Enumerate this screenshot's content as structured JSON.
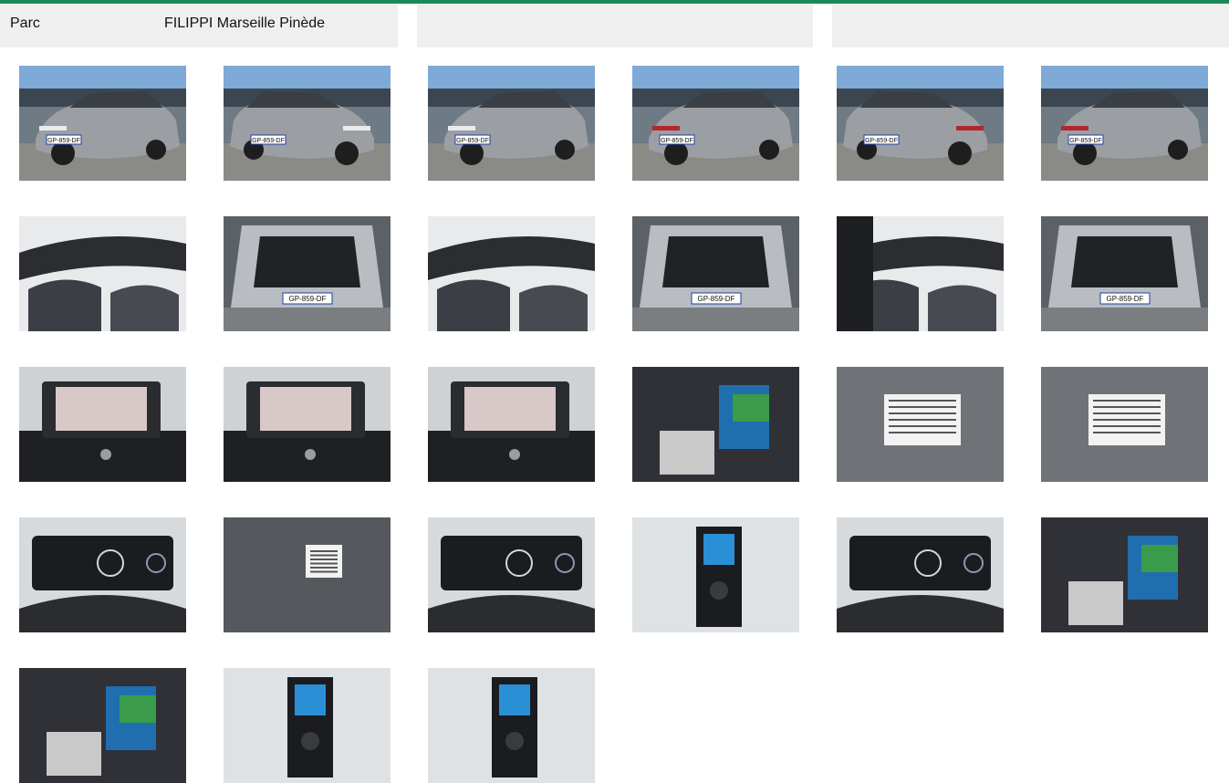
{
  "info": {
    "label": "Parc",
    "value": "FILIPPI Marseille Pinède"
  },
  "photos": [
    {
      "kind": "front-3q-left",
      "plate": "GP-859-DF"
    },
    {
      "kind": "front-3q-right",
      "plate": "GP-859-DF"
    },
    {
      "kind": "front",
      "plate": "GP-859-DF"
    },
    {
      "kind": "rear-3q-left",
      "plate": "GP-859-DF"
    },
    {
      "kind": "rear-3q-right",
      "plate": "GP-859-DF"
    },
    {
      "kind": "rear",
      "plate": "GP-859-DF"
    },
    {
      "kind": "interior-front",
      "plate": ""
    },
    {
      "kind": "trunk-open",
      "plate": "GP-859-DF"
    },
    {
      "kind": "interior-dash",
      "plate": ""
    },
    {
      "kind": "trunk-open",
      "plate": "GP-859-DF"
    },
    {
      "kind": "interior-door",
      "plate": ""
    },
    {
      "kind": "trunk-open",
      "plate": "GP-859-DF"
    },
    {
      "kind": "infotainment",
      "plate": ""
    },
    {
      "kind": "infotainment",
      "plate": ""
    },
    {
      "kind": "infotainment",
      "plate": ""
    },
    {
      "kind": "documents-seat",
      "plate": ""
    },
    {
      "kind": "vin-plate",
      "plate": ""
    },
    {
      "kind": "vin-plate",
      "plate": ""
    },
    {
      "kind": "cluster",
      "plate": ""
    },
    {
      "kind": "vin-plate-far",
      "plate": ""
    },
    {
      "kind": "cluster",
      "plate": ""
    },
    {
      "kind": "cable-compartment",
      "plate": ""
    },
    {
      "kind": "cluster",
      "plate": ""
    },
    {
      "kind": "documents-seat",
      "plate": ""
    },
    {
      "kind": "documents-seat",
      "plate": ""
    },
    {
      "kind": "cable-compartment",
      "plate": ""
    },
    {
      "kind": "cable-compartment",
      "plate": ""
    }
  ]
}
